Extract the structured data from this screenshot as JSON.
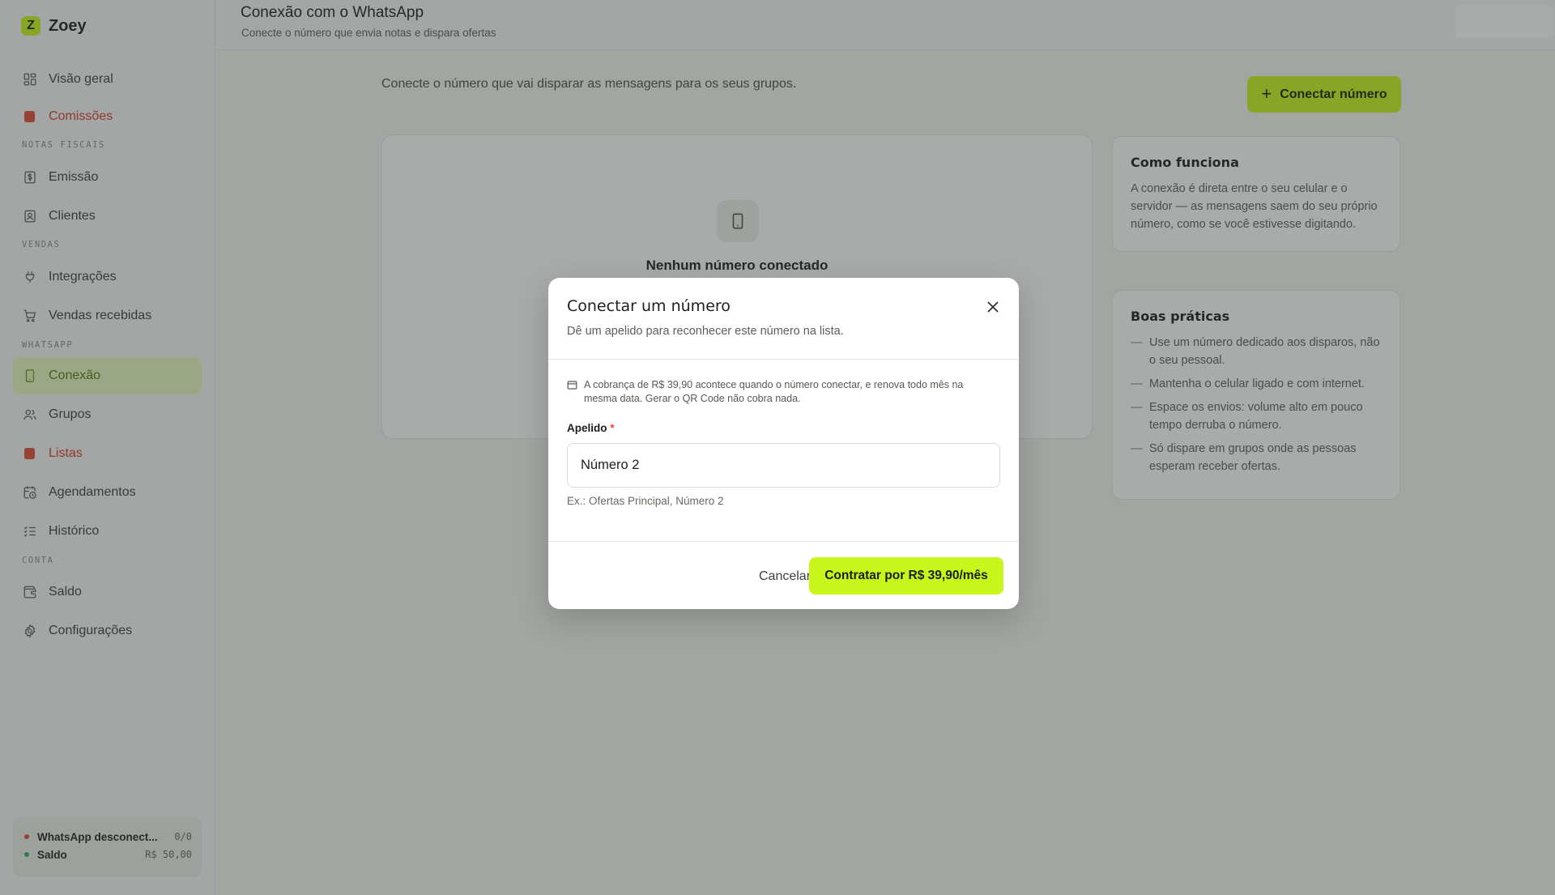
{
  "app": {
    "logo_letter": "Z",
    "name": "Zoey"
  },
  "sidebar": {
    "items": [
      {
        "label": "Visão geral",
        "icon": "grid-icon"
      },
      {
        "label": "Comissões",
        "icon": "bag-icon"
      },
      {
        "label": "Emissão",
        "icon": "receipt-icon"
      },
      {
        "label": "Clientes",
        "icon": "contact-card-icon"
      },
      {
        "label": "Integrações",
        "icon": "plug-icon"
      },
      {
        "label": "Vendas recebidas",
        "icon": "cart-icon"
      },
      {
        "label": "Conexão",
        "icon": "phone-icon"
      },
      {
        "label": "Grupos",
        "icon": "users-icon"
      },
      {
        "label": "Listas",
        "icon": "bag-icon"
      },
      {
        "label": "Agendamentos",
        "icon": "calendar-clock-icon"
      },
      {
        "label": "Histórico",
        "icon": "checklist-icon"
      },
      {
        "label": "Saldo",
        "icon": "wallet-icon"
      },
      {
        "label": "Configurações",
        "icon": "gear-icon"
      }
    ],
    "sections": {
      "notas_fiscais": "NOTAS FISCAIS",
      "vendas": "VENDAS",
      "whatsapp": "WHATSAPP",
      "conta": "CONTA"
    },
    "active_item": "Conexão",
    "status": {
      "whatsapp_label": "WhatsApp desconect...",
      "whatsapp_value": "0/0",
      "saldo_label": "Saldo",
      "saldo_value": "R$ 50,00"
    }
  },
  "header": {
    "title": "Conexão com o WhatsApp",
    "subtitle": "Conecte o número que envia notas e dispara ofertas"
  },
  "main": {
    "intro": "Conecte o número que vai disparar as mensagens para os seus grupos.",
    "connect_button": "Conectar número",
    "empty_title": "Nenhum número conectado",
    "how_it_works": {
      "title": "Como funciona",
      "body": "A conexão é direta entre o seu celular e o servidor — as mensagens saem do seu próprio número, como se você estivesse digitando."
    },
    "best_practices": {
      "title": "Boas práticas",
      "tips": [
        "Use um número dedicado aos disparos, não o seu pessoal.",
        "Mantenha o celular ligado e com internet.",
        "Espace os envios: volume alto em pouco tempo derruba o número.",
        "Só dispare em grupos onde as pessoas esperam receber ofertas."
      ]
    }
  },
  "modal": {
    "title": "Conectar um número",
    "subtitle": "Dê um apelido para reconhecer este número na lista.",
    "billing_note": "A cobrança de R$ 39,90 acontece quando o número conectar, e renova todo mês na mesma data. Gerar o QR Code não cobra nada.",
    "field_label": "Apelido",
    "required_mark": "*",
    "field_value": "Número 2",
    "field_hint": "Ex.: Ofertas Principal, Número 2",
    "cancel_label": "Cancelar",
    "contract_label": "Contratar por R$ 39,90/mês"
  },
  "colors": {
    "accent": "#c8f51a",
    "active_nav_bg": "#e9f7bf",
    "danger": "#e04a35",
    "status_ok": "#27b14a"
  }
}
